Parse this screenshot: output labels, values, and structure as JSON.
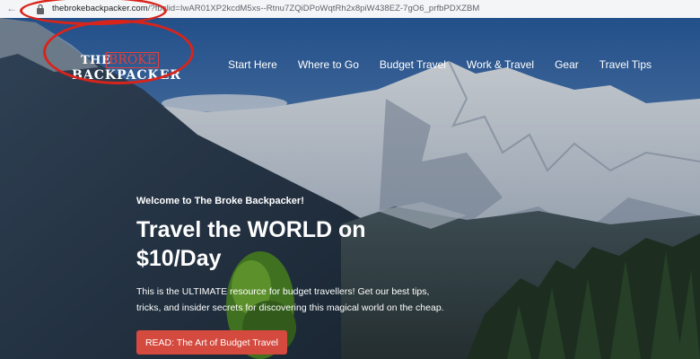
{
  "browser": {
    "url_domain": "thebrokebackpacker.com",
    "url_rest": "/?fbclid=IwAR01XP2kcdM5xs--Rtnu7ZQiDPoWqtRh2x8piW438EZ-7gO6_prfbPDXZBM"
  },
  "logo": {
    "line1_a": "THE",
    "line1_b": "BROKE",
    "line2": "BACKPACKER"
  },
  "nav": {
    "items": [
      "Start Here",
      "Where to Go",
      "Budget Travel",
      "Work & Travel",
      "Gear",
      "Travel Tips"
    ]
  },
  "hero": {
    "welcome": "Welcome to The Broke Backpacker!",
    "headline": "Travel the WORLD on $10/Day",
    "description": "This is the ULTIMATE resource for budget travellers! Get our best tips, tricks, and insider secrets for discovering this magical world on the cheap.",
    "cta_label": "READ: The Art of Budget Travel"
  },
  "colors": {
    "annotation": "#d9241b",
    "cta": "#d44a3e",
    "logo_accent": "#e2403a"
  },
  "icons": [
    "back-arrow-icon",
    "lock-icon"
  ]
}
